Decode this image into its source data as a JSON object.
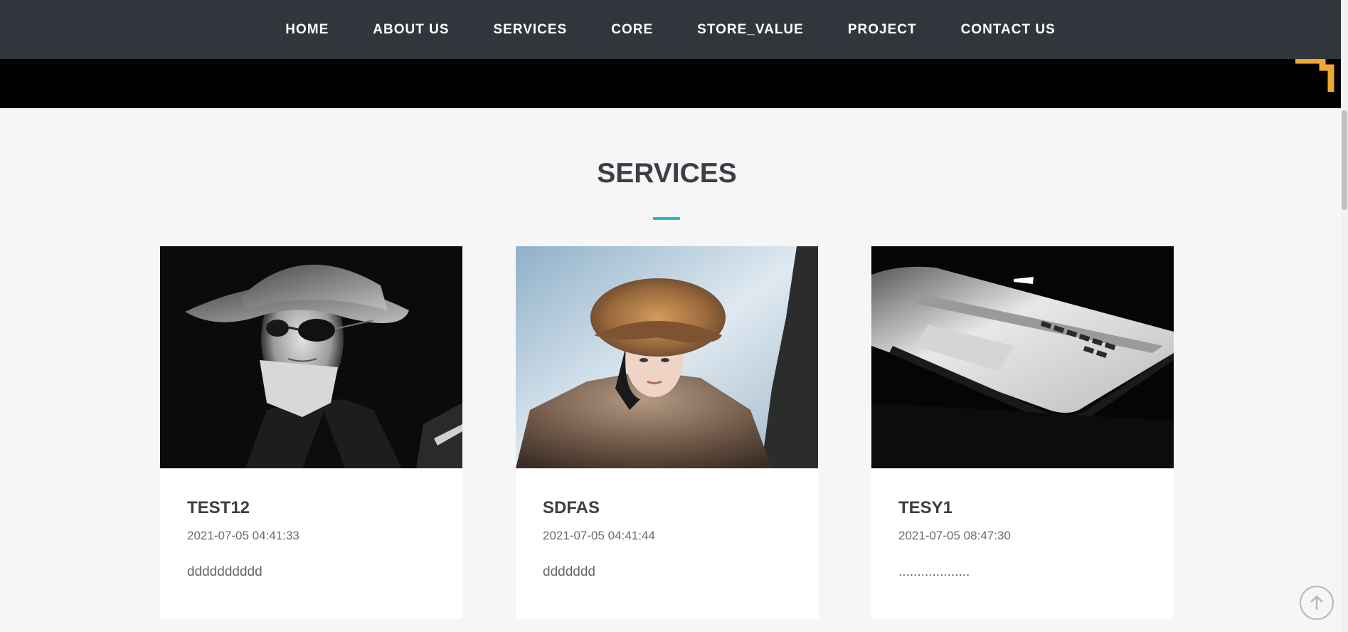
{
  "nav": {
    "items": [
      "HOME",
      "ABOUT US",
      "SERVICES",
      "CORE",
      "STORE_VALUE",
      "PROJECT",
      "CONTACT US"
    ]
  },
  "section": {
    "title": "SERVICES"
  },
  "cards": [
    {
      "title": "TEST12",
      "date": "2021-07-05 04:41:33",
      "text": "dddddddddd",
      "image": "woman-in-hat-sunglasses-photo"
    },
    {
      "title": "SDFAS",
      "date": "2021-07-05 04:41:44",
      "text": "ddddddd",
      "image": "woman-in-fur-hat-snow-photo"
    },
    {
      "title": "TESY1",
      "date": "2021-07-05 08:47:30",
      "text": "...................",
      "image": "laptop-edge-dark-photo"
    }
  ],
  "colors": {
    "nav_bg": "#31363d",
    "accent": "#2ab7ca",
    "hero_bg": "#000000",
    "page_bg": "#f6f6f6",
    "hero_deco": "#f0a830"
  },
  "icons": {
    "back_to_top": "arrow-up-circle-icon"
  }
}
